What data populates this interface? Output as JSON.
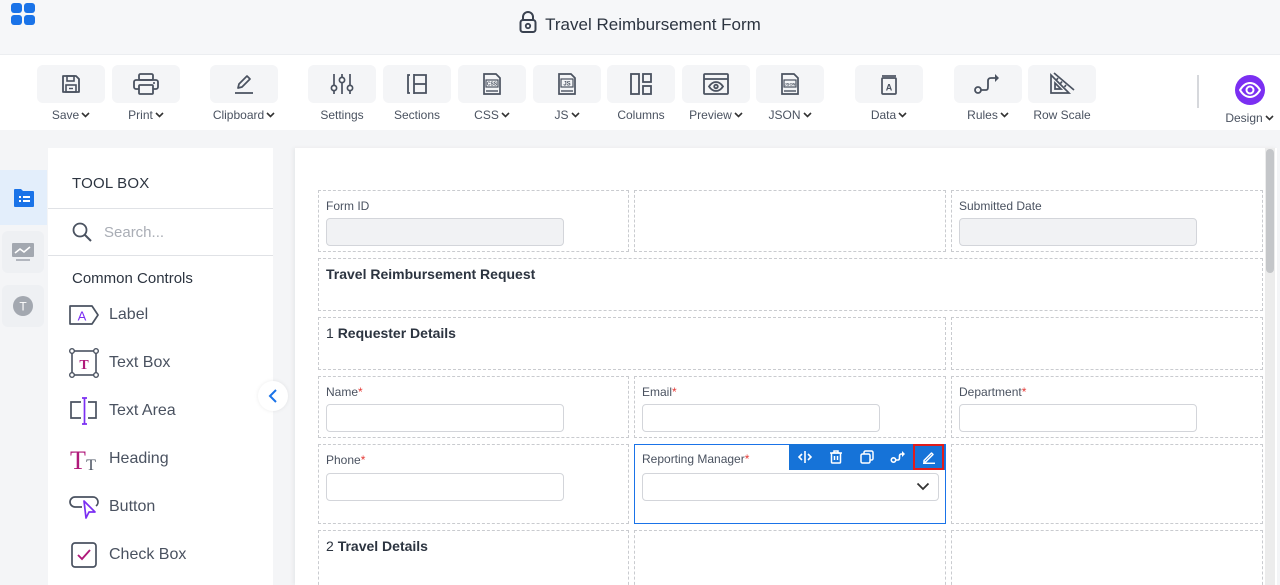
{
  "header": {
    "title": "Travel Reimbursement Form",
    "apps_icon": "grid-icon",
    "lock_icon": "lock-icon"
  },
  "toolbar": {
    "items": [
      {
        "label": "Save",
        "icon": "save-icon",
        "dropdown": true
      },
      {
        "label": "Print",
        "icon": "print-icon",
        "dropdown": true
      },
      {
        "label": "Clipboard",
        "icon": "pencil-icon",
        "dropdown": true
      },
      {
        "label": "Settings",
        "icon": "sliders-icon",
        "dropdown": false
      },
      {
        "label": "Sections",
        "icon": "sections-icon",
        "dropdown": false
      },
      {
        "label": "CSS",
        "icon": "css-file-icon",
        "dropdown": true
      },
      {
        "label": "JS",
        "icon": "js-file-icon",
        "dropdown": true
      },
      {
        "label": "Columns",
        "icon": "columns-icon",
        "dropdown": false
      },
      {
        "label": "Preview",
        "icon": "preview-icon",
        "dropdown": true
      },
      {
        "label": "JSON",
        "icon": "json-file-icon",
        "dropdown": true
      },
      {
        "label": "Data",
        "icon": "data-icon",
        "dropdown": true
      },
      {
        "label": "Rules",
        "icon": "rules-icon",
        "dropdown": true
      },
      {
        "label": "Row Scale",
        "icon": "ruler-icon",
        "dropdown": false
      }
    ],
    "design": {
      "label": "Design",
      "icon": "eye-icon",
      "dropdown": true
    },
    "accent": "#7b2ff2"
  },
  "rail": {
    "items": [
      {
        "name": "toolbox",
        "icon": "folder-list-icon",
        "active": true
      },
      {
        "name": "analytics",
        "icon": "chart-monitor-icon",
        "active": false
      },
      {
        "name": "themes",
        "icon": "t-circle-icon",
        "active": false
      }
    ]
  },
  "toolbox": {
    "title": "TOOL BOX",
    "search_placeholder": "Search...",
    "section": "Common Controls",
    "items": [
      {
        "label": "Label",
        "icon": "label-icon"
      },
      {
        "label": "Text Box",
        "icon": "text-box-icon"
      },
      {
        "label": "Text Area",
        "icon": "text-area-icon"
      },
      {
        "label": "Heading",
        "icon": "heading-icon"
      },
      {
        "label": "Button",
        "icon": "button-icon"
      },
      {
        "label": "Check Box",
        "icon": "check-box-icon"
      }
    ]
  },
  "form": {
    "form_id_label": "Form ID",
    "submitted_date_label": "Submitted Date",
    "form_heading": "Travel Reimbursement Request",
    "section1": {
      "number": "1",
      "title": "Requester Details"
    },
    "name_label": "Name",
    "email_label": "Email",
    "department_label": "Department",
    "phone_label": "Phone",
    "reporting_manager_label": "Reporting Manager",
    "section2": {
      "number": "2",
      "title": "Travel Details"
    },
    "required_mark": "*"
  },
  "control_toolbar": {
    "buttons": [
      {
        "name": "resize",
        "icon": "resize-icon"
      },
      {
        "name": "delete",
        "icon": "trash-icon"
      },
      {
        "name": "duplicate",
        "icon": "copy-icon"
      },
      {
        "name": "rules",
        "icon": "rules-icon"
      },
      {
        "name": "edit",
        "icon": "edit-icon",
        "highlighted": true
      }
    ]
  },
  "colors": {
    "primary": "#1a73e8",
    "design_accent": "#7b2ff2",
    "highlight": "#e01c1c",
    "required": "#e53935"
  }
}
